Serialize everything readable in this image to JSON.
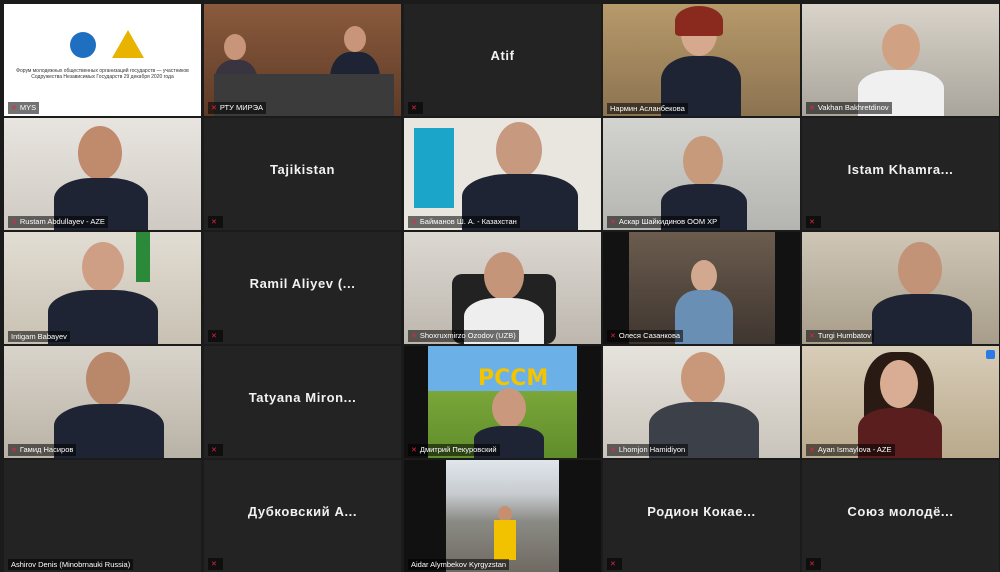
{
  "tiles": [
    {
      "label": "MYS",
      "name": "",
      "kind": "slide",
      "active": true,
      "muted": true,
      "slide_text": "Форум молодежных общественных организаций государств — участников Содружества Независимых Государств 29 декабря 2020 года"
    },
    {
      "label": "РТУ МИРЭА",
      "name": "",
      "kind": "video",
      "muted": true
    },
    {
      "label": "",
      "name": "Atif",
      "kind": "name",
      "muted": true
    },
    {
      "label": "Нармин Асланбекова",
      "name": "",
      "kind": "video",
      "muted": false
    },
    {
      "label": "Vakhan Bakhretdinov",
      "name": "",
      "kind": "video",
      "muted": true
    },
    {
      "label": "Rustam Abdullayev - AZE",
      "name": "",
      "kind": "video",
      "muted": true
    },
    {
      "label": "",
      "name": "Tajikistan",
      "kind": "name",
      "muted": true
    },
    {
      "label": "Байманов Ш. А. - Казахстан",
      "name": "",
      "kind": "video",
      "muted": true
    },
    {
      "label": "Аскар Шайкидинов ООМ ХР",
      "name": "",
      "kind": "video",
      "muted": true
    },
    {
      "label": "",
      "name": "Istam Khamra...",
      "kind": "name",
      "muted": true
    },
    {
      "label": "Intigam Babayev",
      "name": "",
      "kind": "video",
      "muted": false
    },
    {
      "label": "",
      "name": "Ramil Aliyev (...",
      "kind": "name",
      "muted": true
    },
    {
      "label": "Shoxruxmirzo Ozodov (UZB)",
      "name": "",
      "kind": "video",
      "muted": true
    },
    {
      "label": "Олеся Сазанкова",
      "name": "",
      "kind": "video",
      "muted": true
    },
    {
      "label": "Turgi Humbatov",
      "name": "",
      "kind": "video",
      "muted": true
    },
    {
      "label": "Гамид Насиров",
      "name": "",
      "kind": "video",
      "muted": true
    },
    {
      "label": "",
      "name": "Tatyana Miron...",
      "kind": "name",
      "muted": true
    },
    {
      "label": "Дмитрий Пекуровский",
      "name": "",
      "kind": "rssm",
      "muted": true,
      "logo_text": "РССМ"
    },
    {
      "label": "Lhomjon Hamidiyon",
      "name": "",
      "kind": "video",
      "muted": true
    },
    {
      "label": "Ayan Ismaylova - AZE",
      "name": "",
      "kind": "video",
      "muted": true
    },
    {
      "label": "Ashirov Denis (Minobrnauki Russia)",
      "name": "",
      "kind": "name-empty",
      "muted": false
    },
    {
      "label": "",
      "name": "Дубковский А...",
      "kind": "name",
      "muted": true
    },
    {
      "label": "Aidar Alymbekov Kyrgyzstan",
      "name": "",
      "kind": "mountain",
      "muted": false
    },
    {
      "label": "",
      "name": "Родион Кокае...",
      "kind": "name",
      "muted": true
    },
    {
      "label": "",
      "name": "Союз молодё...",
      "kind": "name",
      "muted": true
    }
  ]
}
